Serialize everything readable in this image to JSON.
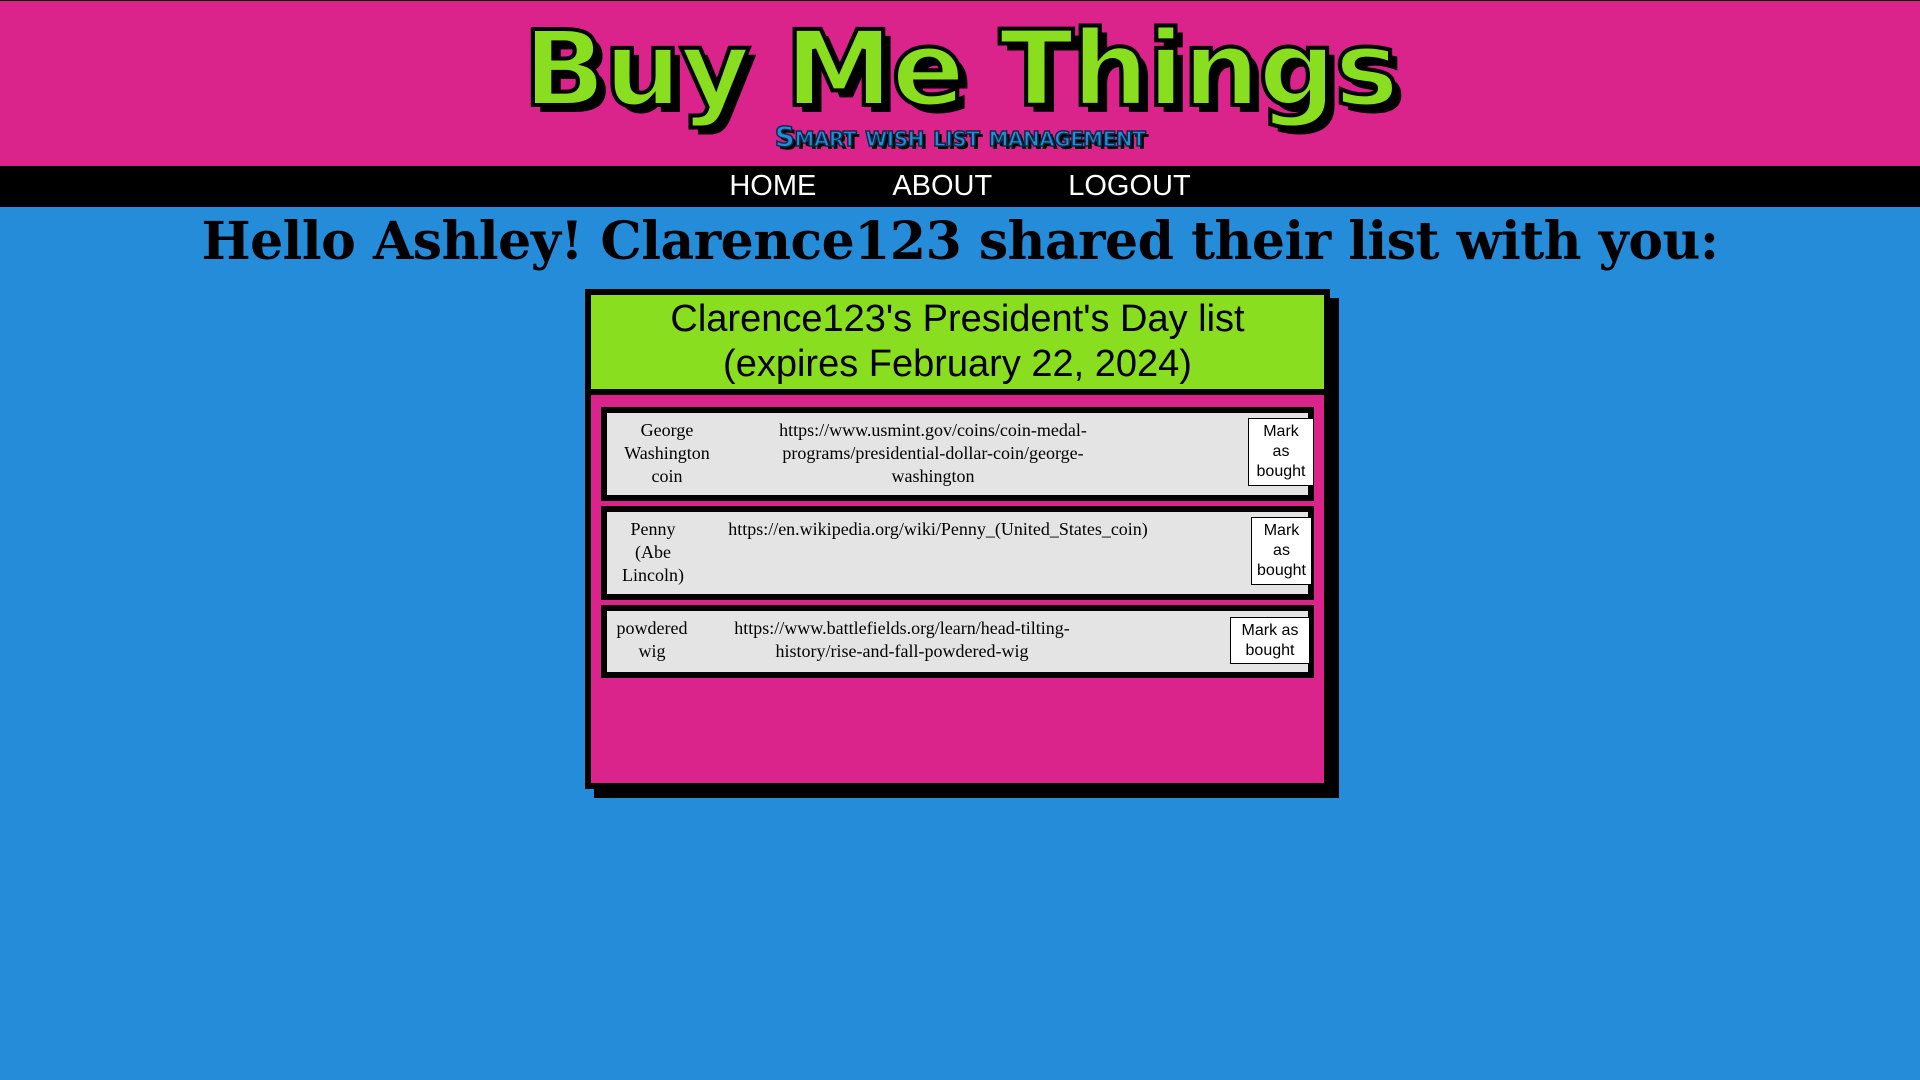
{
  "header": {
    "title": "Buy Me Things",
    "subtitle": "Smart wish list management"
  },
  "nav": {
    "items": [
      {
        "label": "HOME"
      },
      {
        "label": "ABOUT"
      },
      {
        "label": "LOGOUT"
      }
    ]
  },
  "main": {
    "greeting": "Hello Ashley! Clarence123 shared their list with you:",
    "list": {
      "title_line1": "Clarence123's President's Day list",
      "title_line2": "(expires February 22, 2024)",
      "items": [
        {
          "name": "George Washington coin",
          "url": "https://www.usmint.gov/coins/coin-medal-programs/presidential-dollar-coin/george-washington",
          "button": "Mark as bought"
        },
        {
          "name": "Penny (Abe Lincoln)",
          "url": "https://en.wikipedia.org/wiki/Penny_(United_States_coin)",
          "button": "Mark as bought"
        },
        {
          "name": "powdered wig",
          "url": "https://www.battlefields.org/learn/head-tilting-history/rise-and-fall-powdered-wig",
          "button": "Mark as bought"
        }
      ]
    }
  },
  "colors": {
    "page_background": "#258cd9",
    "header_background": "#da248c",
    "accent_green": "#8ade20",
    "nav_background": "#000000",
    "item_background": "#e4e4e4"
  }
}
